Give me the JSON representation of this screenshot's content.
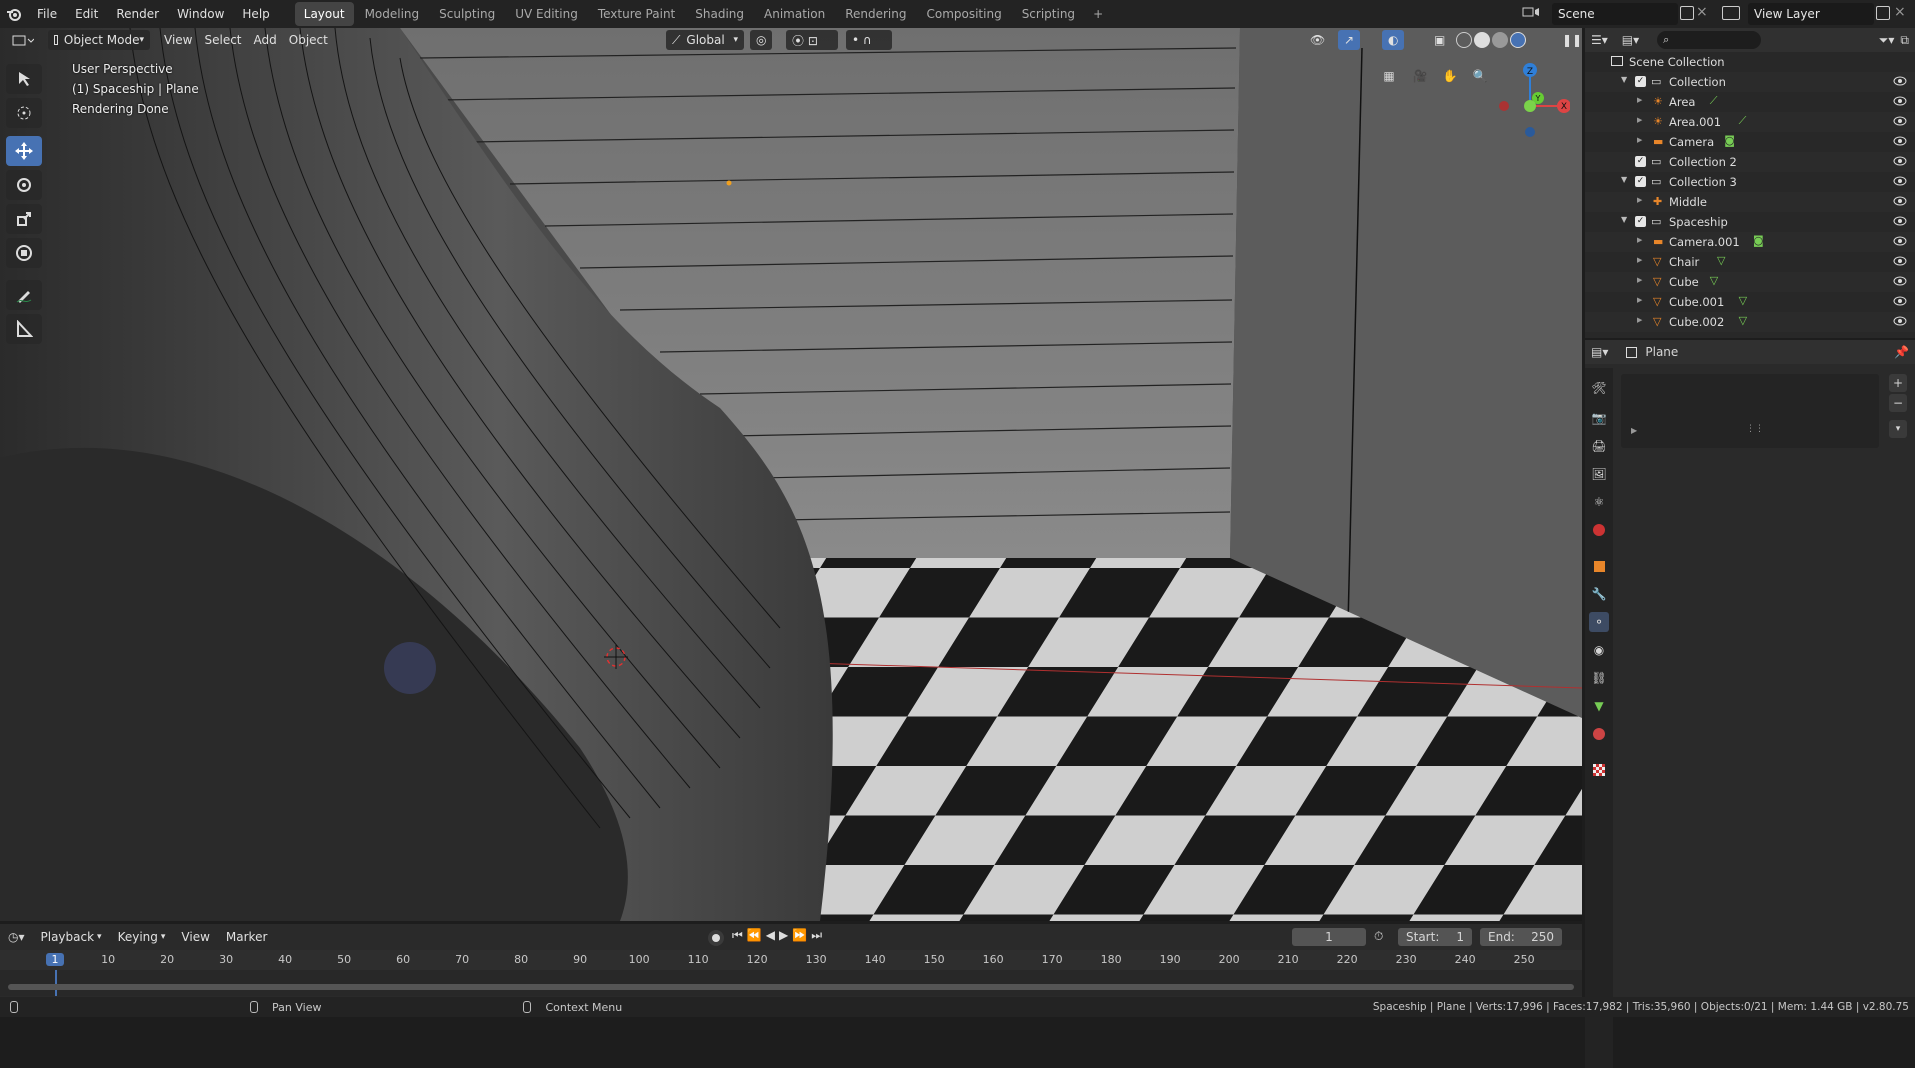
{
  "menu": {
    "file": "File",
    "edit": "Edit",
    "render": "Render",
    "window": "Window",
    "help": "Help"
  },
  "workspaces": [
    "Layout",
    "Modeling",
    "Sculpting",
    "UV Editing",
    "Texture Paint",
    "Shading",
    "Animation",
    "Rendering",
    "Compositing",
    "Scripting"
  ],
  "active_workspace": "Layout",
  "scene": {
    "name": "Scene",
    "view_layer": "View Layer"
  },
  "viewport": {
    "mode": "Object Mode",
    "menus": {
      "view": "View",
      "select": "Select",
      "add": "Add",
      "object": "Object"
    },
    "orientation": "Global",
    "overlay_lines": [
      "User Perspective",
      "(1) Spaceship | Plane",
      "Rendering Done"
    ],
    "gizmo": {
      "z": "Z",
      "y": "Y",
      "x": "X"
    }
  },
  "outliner": {
    "title": "Scene Collection",
    "rows": [
      {
        "label": "Collection",
        "kind": "collection",
        "depth": 1,
        "expanded": true
      },
      {
        "label": "Area",
        "kind": "light",
        "depth": 2
      },
      {
        "label": "Area.001",
        "kind": "light",
        "depth": 2
      },
      {
        "label": "Camera",
        "kind": "camera",
        "depth": 2
      },
      {
        "label": "Collection 2",
        "kind": "collection",
        "depth": 1
      },
      {
        "label": "Collection 3",
        "kind": "collection",
        "depth": 1,
        "expanded": true
      },
      {
        "label": "Middle",
        "kind": "empty",
        "depth": 2
      },
      {
        "label": "Spaceship",
        "kind": "collection",
        "depth": 1,
        "expanded": true
      },
      {
        "label": "Camera.001",
        "kind": "camera",
        "depth": 2
      },
      {
        "label": "Chair",
        "kind": "mesh",
        "depth": 2
      },
      {
        "label": "Cube",
        "kind": "mesh",
        "depth": 2
      },
      {
        "label": "Cube.001",
        "kind": "mesh",
        "depth": 2
      },
      {
        "label": "Cube.002",
        "kind": "mesh",
        "depth": 2
      }
    ]
  },
  "properties": {
    "object_name": "Plane"
  },
  "timeline": {
    "menus": {
      "playback": "Playback",
      "keying": "Keying",
      "view": "View",
      "marker": "Marker"
    },
    "current_frame": "1",
    "start_label": "Start:",
    "start": "1",
    "end_label": "End:",
    "end": "250",
    "ruler": [
      "1",
      "10",
      "20",
      "30",
      "40",
      "50",
      "60",
      "70",
      "80",
      "90",
      "100",
      "110",
      "120",
      "130",
      "140",
      "150",
      "160",
      "170",
      "180",
      "190",
      "200",
      "210",
      "220",
      "230",
      "240",
      "250"
    ]
  },
  "status": {
    "pan": "Pan View",
    "context": "Context Menu",
    "stats": "Spaceship | Plane | Verts:17,996 | Faces:17,982 | Tris:35,960 | Objects:0/21 | Mem: 1.44 GB | v2.80.75"
  }
}
